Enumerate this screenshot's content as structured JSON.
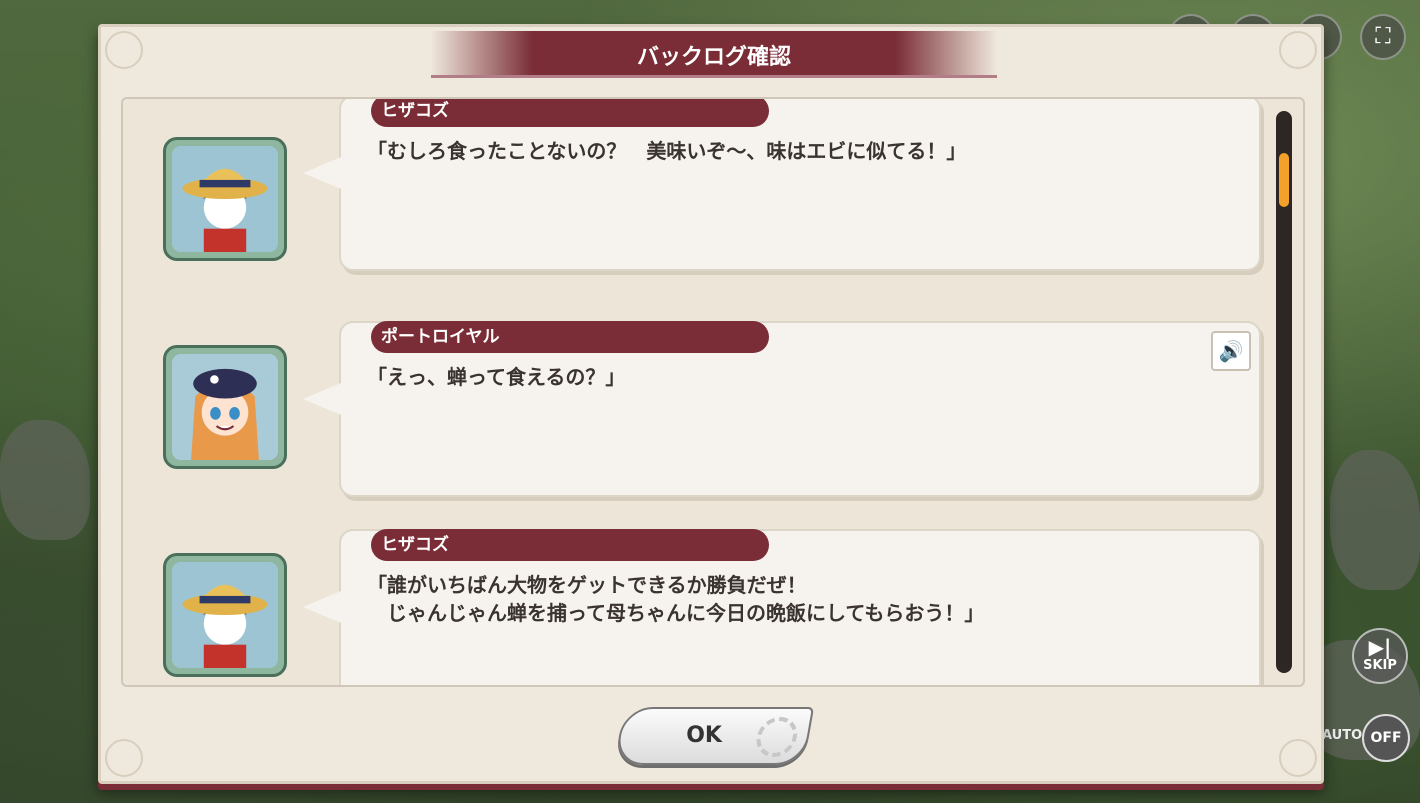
{
  "dialog": {
    "title": "バックログ確認",
    "ok_label": "OK"
  },
  "entries": [
    {
      "speaker": "ヒザコズ",
      "text": "「むしろ食ったことないの？　美味いぞ〜、味はエビに似てる！」",
      "has_voice": false
    },
    {
      "speaker": "ポートロイヤル",
      "text": "「えっ、蝉って食えるの？」",
      "has_voice": true
    },
    {
      "speaker": "ヒザコズ",
      "text": "「誰がいちばん大物をゲットできるか勝負だぜ！\n　じゃんじゃん蝉を捕って母ちゃんに今日の晩飯にしてもらおう！」",
      "has_voice": false
    }
  ],
  "side_controls": {
    "skip_label": "SKIP",
    "auto_label": "AUTO",
    "auto_state": "OFF"
  },
  "colors": {
    "accent": "#7a2d36",
    "scroll_thumb": "#f3a12a",
    "panel": "#efe8dc"
  },
  "icons": [
    "fullscreen-icon",
    "voice-speaker-icon",
    "skip-icon",
    "play-icon",
    "gear-icon"
  ]
}
